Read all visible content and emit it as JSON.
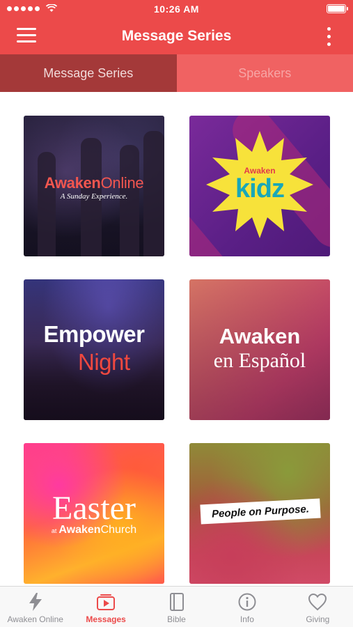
{
  "status_bar": {
    "time": "10:26 AM"
  },
  "header": {
    "title": "Message Series"
  },
  "tabs": [
    {
      "label": "Message Series",
      "active": true
    },
    {
      "label": "Speakers",
      "active": false
    }
  ],
  "series": [
    {
      "title_a": "Awaken",
      "title_b": "Online",
      "subtitle": "A Sunday Experience."
    },
    {
      "title_a": "Awaken",
      "title_b": "kidz"
    },
    {
      "title_a": "Empower",
      "title_b": "Night"
    },
    {
      "title_a": "Awaken",
      "title_b": "en Español"
    },
    {
      "title_a": "Easter",
      "at": "at",
      "brand_a": "Awaken",
      "brand_b": "Church"
    },
    {
      "title_a": "People on Purpose."
    }
  ],
  "bottom_nav": [
    {
      "label": "Awaken Online",
      "icon": "lightning-icon",
      "active": false
    },
    {
      "label": "Messages",
      "icon": "play-video-icon",
      "active": true
    },
    {
      "label": "Bible",
      "icon": "book-icon",
      "active": false
    },
    {
      "label": "Info",
      "icon": "info-icon",
      "active": false
    },
    {
      "label": "Giving",
      "icon": "heart-icon",
      "active": false
    }
  ],
  "colors": {
    "brand_red": "#ec4a4a",
    "tab_active_bg": "#a43939",
    "tab_inactive_bg": "#f06262",
    "inactive_nav": "#8e8e93"
  }
}
